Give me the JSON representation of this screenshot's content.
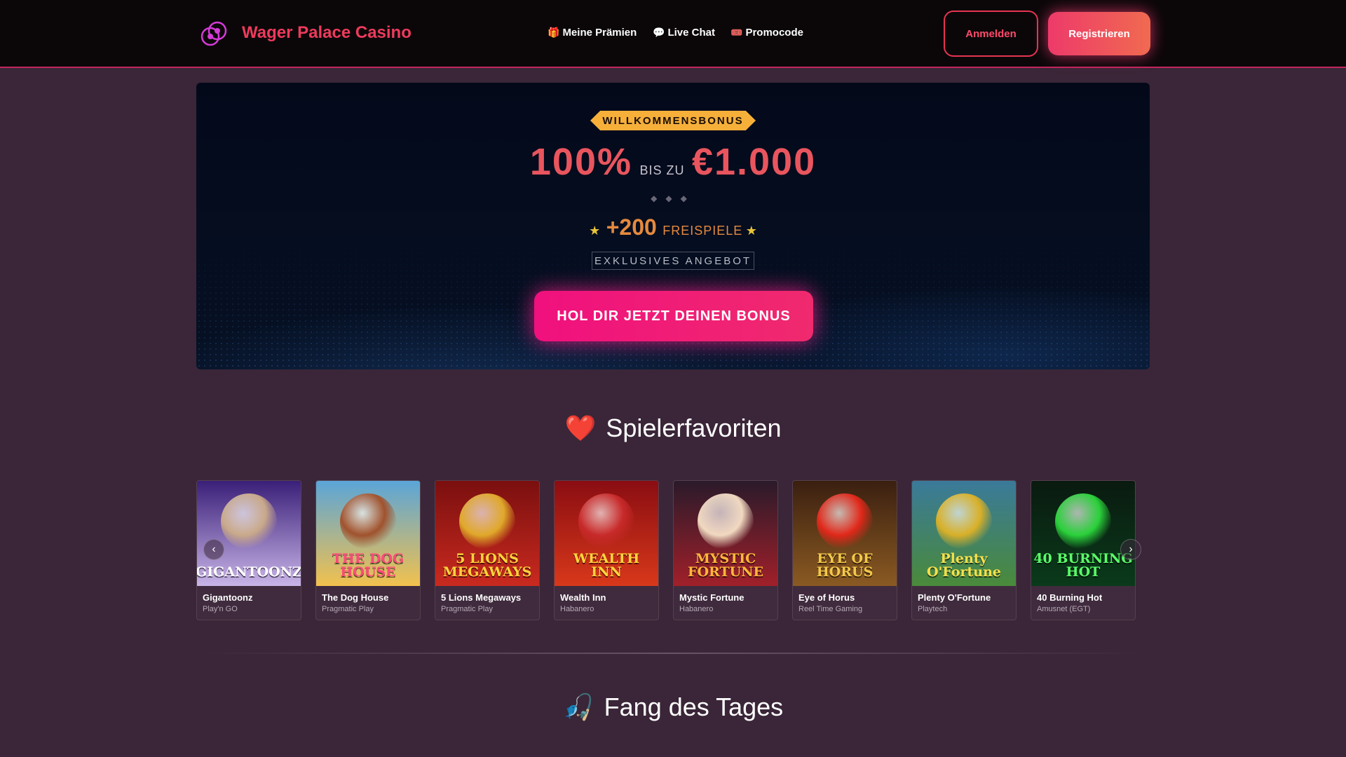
{
  "header": {
    "brand": "Wager Palace Casino",
    "nav": [
      {
        "icon": "🎁",
        "label": "Meine Prämien"
      },
      {
        "icon": "💬",
        "label": "Live Chat"
      },
      {
        "icon": "🎟️",
        "label": "Promocode"
      }
    ],
    "login_label": "Anmelden",
    "register_label": "Registrieren"
  },
  "hero": {
    "badge": "WILLKOMMENSBONUS",
    "percent": "100%",
    "upto": "BIS ZU",
    "amount": "€1.000",
    "diamonds": "◆◆◆",
    "star": "★",
    "spins_count": "+200",
    "spins_label": "FREISPIELE",
    "exclusive": "EXKLUSIVES ANGEBOT",
    "cta": "HOL DIR JETZT DEINEN BONUS"
  },
  "favorites": {
    "emoji": "❤️",
    "title": "Spielerfavoriten",
    "games": [
      {
        "name": "Gigantoonz",
        "provider": "Play'n GO",
        "art": "GIGANTOONZ",
        "bg1": "#3a1f78",
        "bg2": "#c9b4e8",
        "fg": "#ffffff",
        "deco": "#c9a98a"
      },
      {
        "name": "The Dog House",
        "provider": "Pragmatic Play",
        "art": "THE DOG HOUSE",
        "bg1": "#5aa5d8",
        "bg2": "#f2c14e",
        "fg": "#ff4a7a",
        "deco": "#a0522d"
      },
      {
        "name": "5 Lions Megaways",
        "provider": "Pragmatic Play",
        "art": "5 LIONS MEGAWAYS",
        "bg1": "#7a0f0f",
        "bg2": "#c92a1f",
        "fg": "#ffd23a",
        "deco": "#e0a82a"
      },
      {
        "name": "Wealth Inn",
        "provider": "Habanero",
        "art": "WEALTH INN",
        "bg1": "#8a0d12",
        "bg2": "#d8381a",
        "fg": "#ffd43a",
        "deco": "#c82a2a"
      },
      {
        "name": "Mystic Fortune",
        "provider": "Habanero",
        "art": "MYSTIC FORTUNE",
        "bg1": "#2a1a2a",
        "bg2": "#a0202a",
        "fg": "#ffb73a",
        "deco": "#f0d8c0"
      },
      {
        "name": "Eye of Horus",
        "provider": "Reel Time Gaming",
        "art": "EYE OF HORUS",
        "bg1": "#3a1f10",
        "bg2": "#8a5a22",
        "fg": "#f2c84a",
        "deco": "#e0281a"
      },
      {
        "name": "Plenty O'Fortune",
        "provider": "Playtech",
        "art": "Plenty O'Fortune",
        "bg1": "#3a7a9a",
        "bg2": "#4a8a3a",
        "fg": "#f6e04a",
        "deco": "#d8b028"
      },
      {
        "name": "40 Burning Hot",
        "provider": "Amusnet (EGT)",
        "art": "40 BURNING HOT",
        "bg1": "#0a1a10",
        "bg2": "#0a3a1a",
        "fg": "#5cff6a",
        "deco": "#2ad03a"
      }
    ]
  },
  "catch": {
    "emoji": "🎣",
    "title": "Fang des Tages"
  },
  "colors": {
    "accent": "#ee3a5c",
    "background": "#3a2638",
    "cta": "#f0107e",
    "gold": "#f6b03a"
  }
}
